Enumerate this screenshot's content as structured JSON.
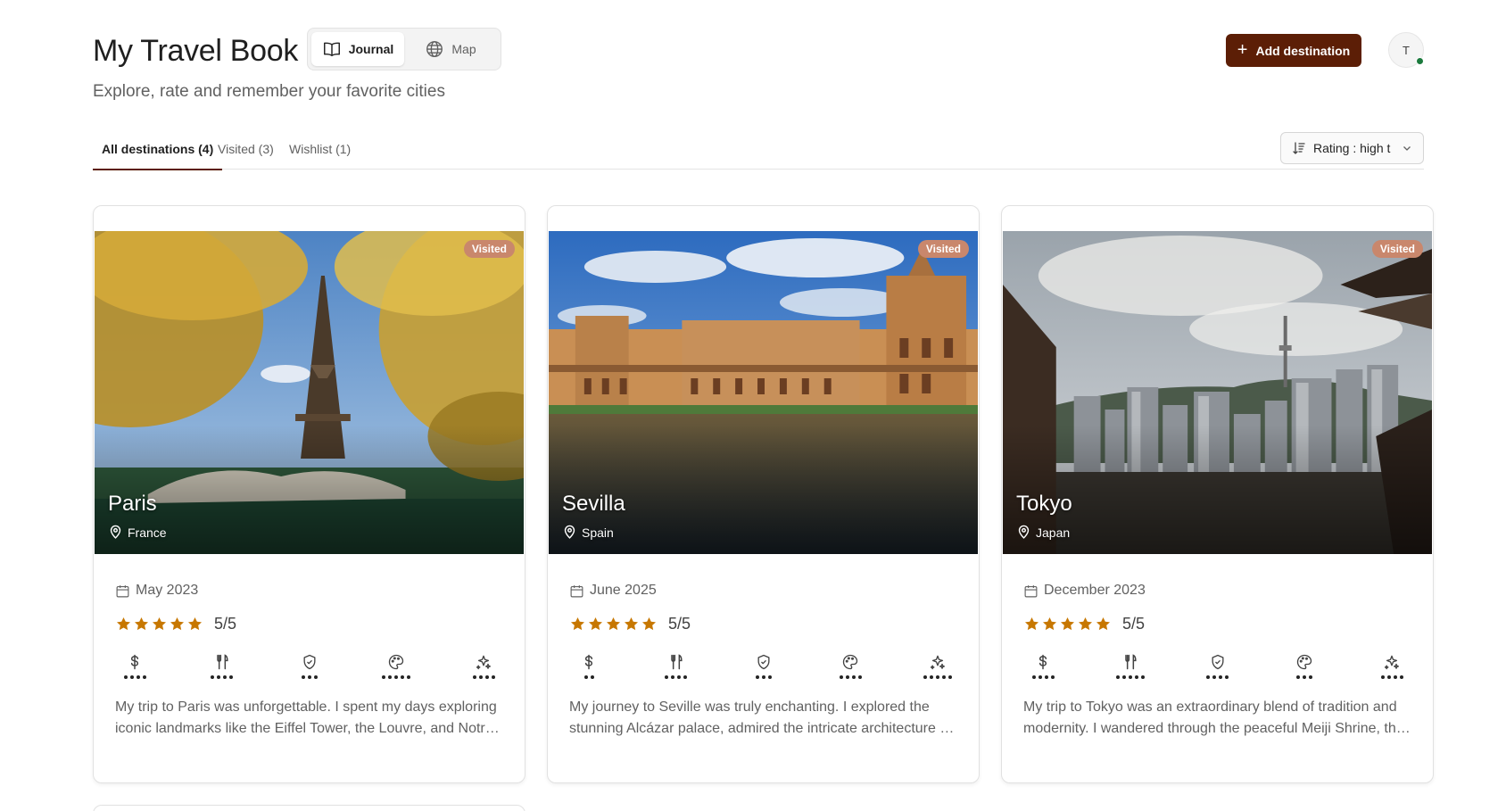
{
  "header": {
    "title": "My Travel Book",
    "subtitle": "Explore, rate and remember your favorite cities",
    "view_toggle": {
      "journal_label": "Journal",
      "map_label": "Map",
      "active": "journal"
    },
    "add_button_label": "Add destination",
    "avatar_initial": "T"
  },
  "tabs": [
    {
      "label": "All destinations (4)",
      "active": true
    },
    {
      "label": "Visited (3)",
      "active": false
    },
    {
      "label": "Wishlist (1)",
      "active": false
    }
  ],
  "sort": {
    "label": "Rating : high t"
  },
  "cards": [
    {
      "city": "Paris",
      "country": "France",
      "badge": "Visited",
      "date": "May 2023",
      "rating_text": "5/5",
      "stars": 5,
      "metrics": {
        "cost": 4,
        "food": 4,
        "safety": 3,
        "culture": 5,
        "fun": 4
      },
      "description": "My trip to Paris was unforgettable. I spent my days exploring iconic landmarks like the Eiffel Tower, the Louvre, and Notre-Dame..."
    },
    {
      "city": "Sevilla",
      "country": "Spain",
      "badge": "Visited",
      "date": "June 2025",
      "rating_text": "5/5",
      "stars": 5,
      "metrics": {
        "cost": 2,
        "food": 4,
        "safety": 3,
        "culture": 4,
        "fun": 5
      },
      "description": "My journey to Seville was truly enchanting. I explored the stunning Alcázar palace, admired the intricate architecture of the cathedral..."
    },
    {
      "city": "Tokyo",
      "country": "Japan",
      "badge": "Visited",
      "date": "December 2023",
      "rating_text": "5/5",
      "stars": 5,
      "metrics": {
        "cost": 4,
        "food": 5,
        "safety": 4,
        "culture": 3,
        "fun": 4
      },
      "description": "My trip to Tokyo was an extraordinary blend of tradition and modernity. I wandered through the peaceful Meiji Shrine, the vibrant streets..."
    }
  ],
  "colors": {
    "brand": "#5c1e06",
    "badge": "#c9876c",
    "star": "#c77700"
  }
}
